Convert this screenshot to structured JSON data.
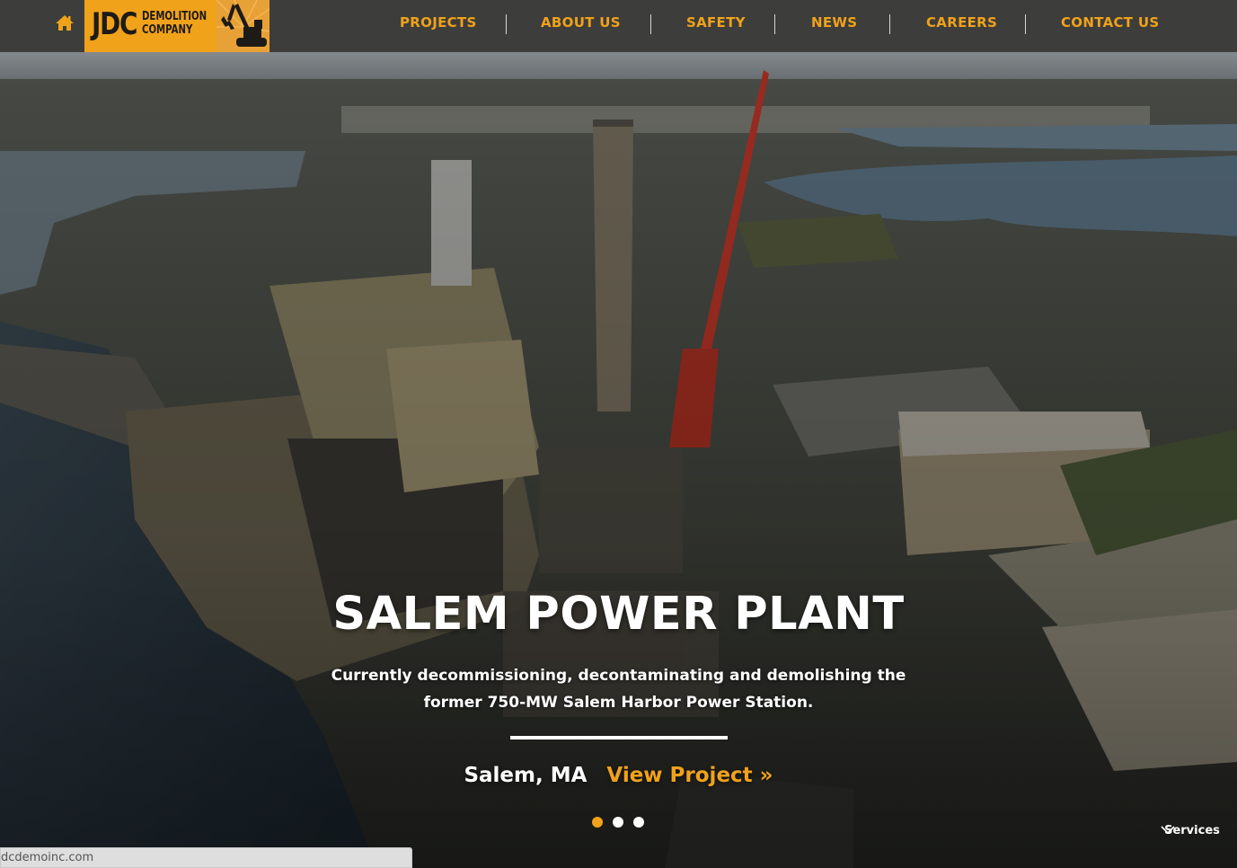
{
  "header": {
    "home_icon": "home-icon",
    "logo": {
      "main": "JDC",
      "line1": "DEMOLITION",
      "line2": "COMPANY",
      "accent": "#f0a21b"
    },
    "nav": [
      {
        "label": "PROJECTS"
      },
      {
        "label": "ABOUT US"
      },
      {
        "label": "SAFETY"
      },
      {
        "label": "NEWS"
      },
      {
        "label": "CAREERS"
      },
      {
        "label": "CONTACT US"
      }
    ]
  },
  "hero": {
    "title": "SALEM POWER PLANT",
    "description_line1": "Currently decommissioning, decontaminating and demolishing the",
    "description_line2": "former 750-MW Salem Harbor Power Station.",
    "location": "Salem, MA",
    "link": "View Project »",
    "slides": {
      "count": 3,
      "active": 1
    }
  },
  "services": {
    "label": "Services",
    "icon": "chevron-down-icon"
  },
  "status_bar": {
    "text": "dcdemoinc.com"
  },
  "colors": {
    "accent": "#f0a21b",
    "header_bg": "#3d3d3b"
  }
}
